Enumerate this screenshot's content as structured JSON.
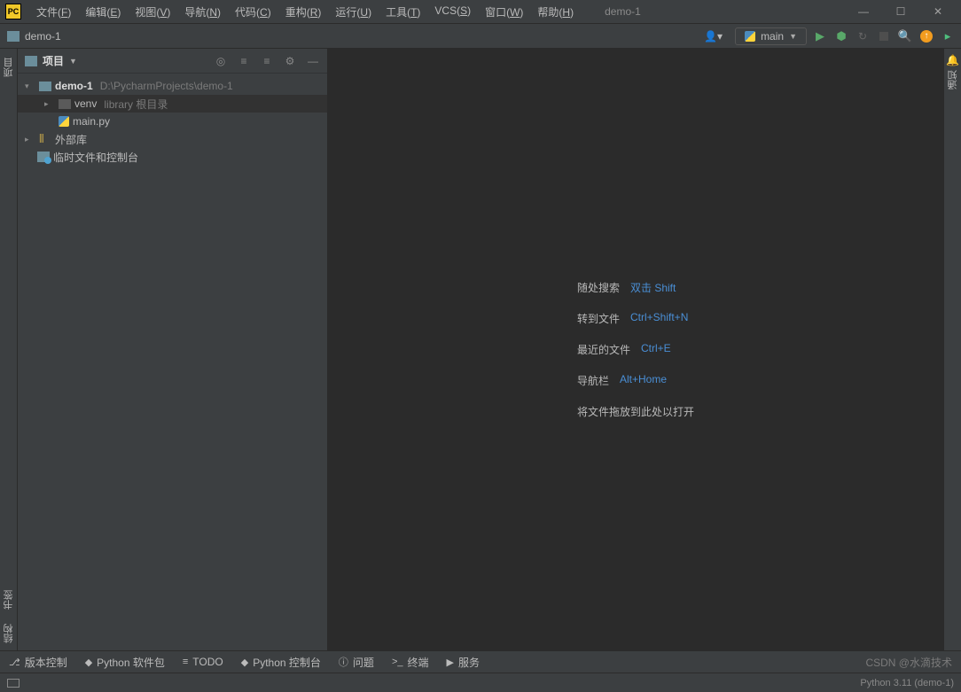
{
  "window": {
    "title": "demo-1",
    "menus": [
      "文件(F)",
      "编辑(E)",
      "视图(V)",
      "导航(N)",
      "代码(C)",
      "重构(R)",
      "运行(U)",
      "工具(T)",
      "VCS(S)",
      "窗口(W)",
      "帮助(H)"
    ],
    "controls": {
      "min": "—",
      "max": "☐",
      "close": "✕"
    }
  },
  "toolbar": {
    "breadcrumb": "demo-1",
    "add_label": "▾",
    "config": "main",
    "user_icon": "👤"
  },
  "left_gutter": {
    "project": "项目",
    "bookmarks": "书签",
    "structure": "结构"
  },
  "right_gutter": {
    "notifications": "通知"
  },
  "sidebar": {
    "title": "项目",
    "root": {
      "name": "demo-1",
      "path": "D:\\PycharmProjects\\demo-1"
    },
    "venv": {
      "name": "venv",
      "hint": "library 根目录"
    },
    "main": {
      "name": "main.py"
    },
    "ext": {
      "name": "外部库"
    },
    "scratch": {
      "name": "临时文件和控制台"
    }
  },
  "editor": {
    "shortcuts": [
      {
        "label": "随处搜索",
        "key": "双击 Shift"
      },
      {
        "label": "转到文件",
        "key": "Ctrl+Shift+N"
      },
      {
        "label": "最近的文件",
        "key": "Ctrl+E"
      },
      {
        "label": "导航栏",
        "key": "Alt+Home"
      },
      {
        "label": "将文件拖放到此处以打开",
        "key": ""
      }
    ]
  },
  "bottom": {
    "items": [
      {
        "icon": "⎇",
        "label": "版本控制"
      },
      {
        "icon": "◆",
        "label": "Python 软件包"
      },
      {
        "icon": "≡",
        "label": "TODO"
      },
      {
        "icon": "◆",
        "label": "Python 控制台"
      },
      {
        "icon": "ⓘ",
        "label": "问题"
      },
      {
        "icon": ">_",
        "label": "终端"
      },
      {
        "icon": "▶",
        "label": "服务"
      }
    ],
    "watermark": "CSDN @水滴技术"
  },
  "status": {
    "interpreter": "Python 3.11 (demo-1)"
  }
}
